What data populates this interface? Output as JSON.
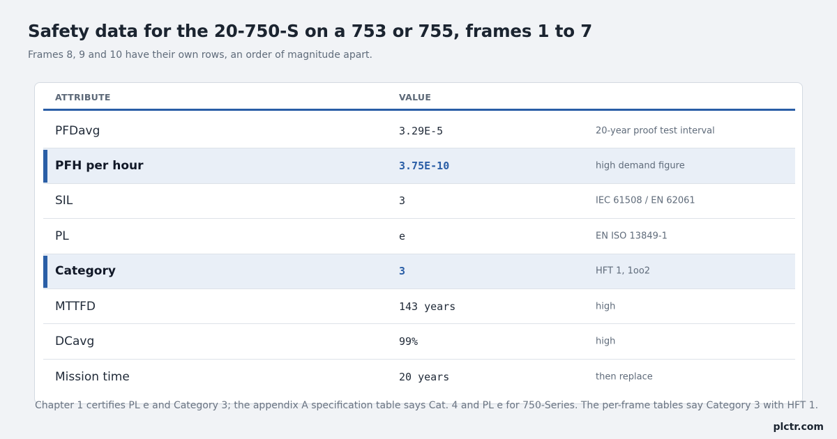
{
  "title": "Safety data for the 20-750-S on a 753 or 755, frames 1 to 7",
  "subtitle": "Frames 8, 9 and 10 have their own rows, an order of magnitude apart.",
  "table": {
    "headers": {
      "attribute": "ATTRIBUTE",
      "value": "VALUE"
    },
    "rows": [
      {
        "attribute": "PFDavg",
        "value": "3.29E-5",
        "note": "20-year proof test interval",
        "highlight": false
      },
      {
        "attribute": "PFH per hour",
        "value": "3.75E-10",
        "note": "high demand figure",
        "highlight": true
      },
      {
        "attribute": "SIL",
        "value": "3",
        "note": "IEC 61508 / EN 62061",
        "highlight": false
      },
      {
        "attribute": "PL",
        "value": "e",
        "note": "EN ISO 13849-1",
        "highlight": false
      },
      {
        "attribute": "Category",
        "value": "3",
        "note": "HFT 1, 1oo2",
        "highlight": true
      },
      {
        "attribute": "MTTFD",
        "value": "143 years",
        "note": "high",
        "highlight": false
      },
      {
        "attribute": "DCavg",
        "value": "99%",
        "note": "high",
        "highlight": false
      },
      {
        "attribute": "Mission time",
        "value": "20 years",
        "note": "then replace",
        "highlight": false
      }
    ]
  },
  "footnote": "Chapter 1 certifies PL e and Category 3; the appendix A specification table says Cat. 4 and PL e for 750-Series. The per-frame tables say Category 3 with HFT 1.",
  "brand": "plctr.com",
  "colors": {
    "accent": "#2a5ea6",
    "highlight_bg": "#e9eff7",
    "page_bg": "#f1f3f6"
  }
}
